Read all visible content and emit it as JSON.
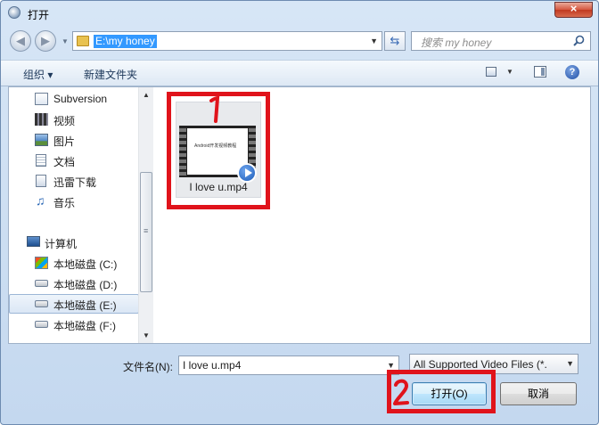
{
  "window": {
    "title": "打开",
    "close_glyph": "×"
  },
  "address": {
    "path": "E:\\my honey",
    "search_placeholder": "搜索 my honey"
  },
  "toolbar": {
    "organize_label": "组织 ▾",
    "new_folder_label": "新建文件夹",
    "help_glyph": "?"
  },
  "nav": {
    "items": [
      {
        "label": "Subversion"
      },
      {
        "label": "视频"
      },
      {
        "label": "图片"
      },
      {
        "label": "文档"
      },
      {
        "label": "迅雷下载"
      },
      {
        "label": "音乐"
      },
      {
        "label": "计算机"
      },
      {
        "label": "本地磁盘 (C:)"
      },
      {
        "label": "本地磁盘 (D:)"
      },
      {
        "label": "本地磁盘 (E:)"
      },
      {
        "label": "本地磁盘 (F:)"
      }
    ],
    "selected_label": "本地磁盘 (E:)"
  },
  "files": [
    {
      "name": "I love u.mp4",
      "thumbnail_caption": "Android开发视频教程"
    }
  ],
  "footer": {
    "filename_label": "文件名(N):",
    "filename_value": "I love u.mp4",
    "filter_value": "All Supported Video Files (*.",
    "open_label": "打开(O)",
    "cancel_label": "取消"
  },
  "colors": {
    "annotation_red": "#e0131b",
    "selection_blue": "#3399ff"
  }
}
